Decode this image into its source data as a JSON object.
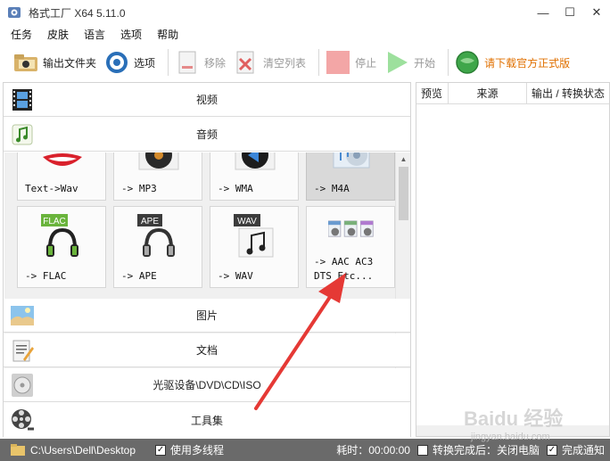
{
  "window": {
    "title": "格式工厂 X64 5.11.0"
  },
  "menu": {
    "items": [
      "任务",
      "皮肤",
      "语言",
      "选项",
      "帮助"
    ]
  },
  "toolbar": {
    "output_folder": "输出文件夹",
    "options": "选项",
    "remove": "移除",
    "clear_list": "清空列表",
    "stop": "停止",
    "start": "开始",
    "download": "请下载官方正式版"
  },
  "categories": {
    "video": "视频",
    "audio": "音频",
    "image": "图片",
    "document": "文档",
    "disc": "光驱设备\\DVD\\CD\\ISO",
    "tools": "工具集"
  },
  "tiles": [
    {
      "label": "Text->Wav",
      "icon": "lips-icon",
      "selected": false
    },
    {
      "label": "-> MP3",
      "icon": "mp3-disc-icon",
      "selected": false
    },
    {
      "label": "-> WMA",
      "icon": "wma-disc-icon",
      "selected": false
    },
    {
      "label": "-> M4A",
      "icon": "m4a-icon",
      "selected": true
    },
    {
      "label": "-> FLAC",
      "icon": "flac-headphones-icon",
      "selected": false
    },
    {
      "label": "-> APE",
      "icon": "ape-headphones-icon",
      "selected": false
    },
    {
      "label": "-> WAV",
      "icon": "wav-note-icon",
      "selected": false
    },
    {
      "label": "-> AAC AC3\nDTS Etc...",
      "icon": "multi-audio-icon",
      "selected": false
    }
  ],
  "tile_badges": {
    "flac": "FLAC",
    "ape": "APE",
    "wav": "WAV"
  },
  "task_list": {
    "columns": [
      "预览",
      "来源",
      "输出 / 转换状态"
    ]
  },
  "status": {
    "output_path": "C:\\Users\\Dell\\Desktop",
    "multithread": "使用多线程",
    "elapsed": "耗时：00:00:00",
    "after_convert": "转换完成后：关闭电脑",
    "notify": "完成通知"
  },
  "watermark": {
    "brand": "Baidu 经验",
    "url": "jingyan.baidu.com"
  },
  "colors": {
    "status_bg": "#6a6a6a",
    "promo": "#e07000",
    "arrow": "#e53935"
  }
}
